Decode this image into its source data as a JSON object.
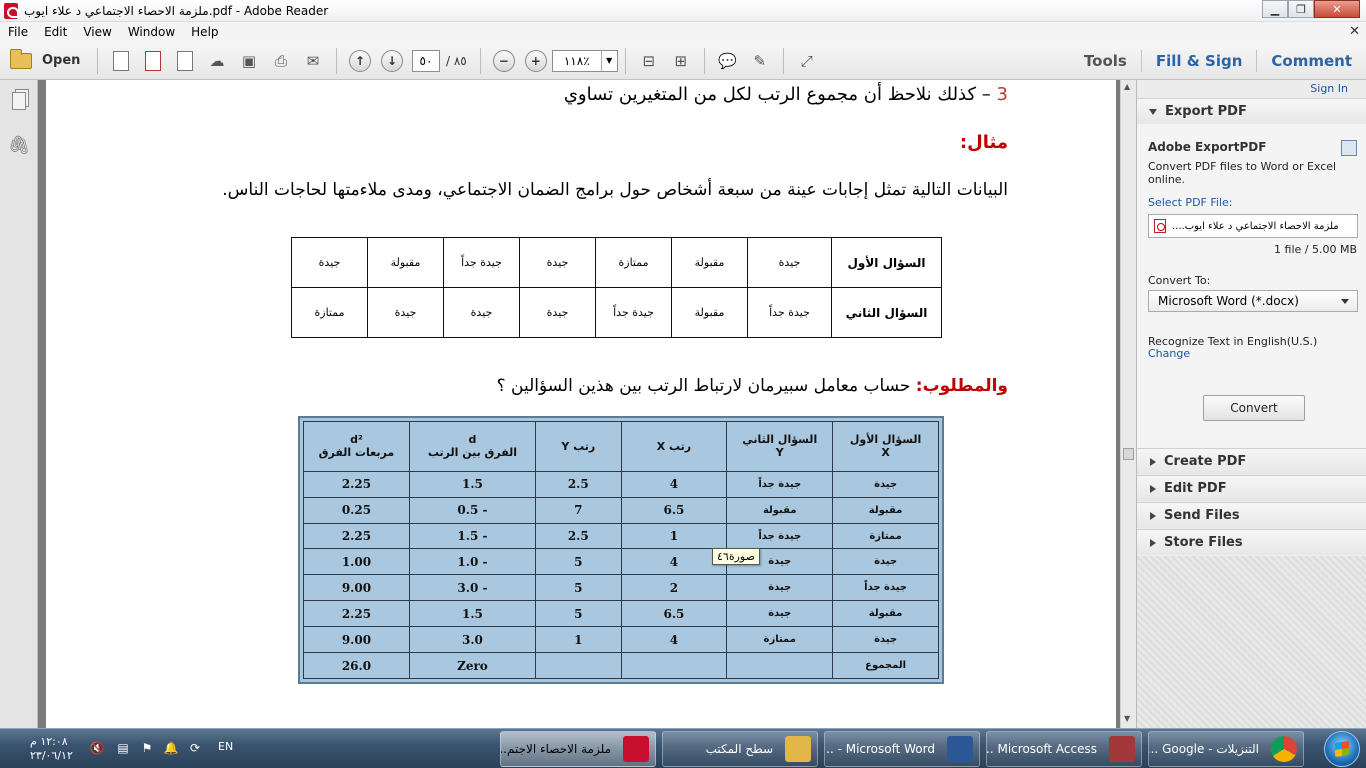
{
  "window": {
    "title": "ملزمة الاحصاء الاجتماعي د علاء ايوب.pdf - Adobe Reader"
  },
  "menu": [
    "File",
    "Edit",
    "View",
    "Window",
    "Help"
  ],
  "toolbar": {
    "open_label": "Open",
    "page_current": "٥٠",
    "page_total": "/ ٨٥",
    "zoom": "١١٨٪",
    "tools_label": "Tools",
    "fill_sign_label": "Fill & Sign",
    "comment_label": "Comment"
  },
  "document": {
    "line1_num": "3",
    "line1_text": "– كذلك نلاحظ أن مجموع الرتب لكل من المتغيرين تساوي",
    "example_heading": "مثال:",
    "intro_text": "البيانات التالية تمثل إجابات عينة من سبعة أشخاص حول برامج الضمان الاجتماعي، ومدى ملاءمتها لحاجات الناس.",
    "table1": {
      "rows": [
        [
          "السؤال الأول",
          "جيدة",
          "مقبولة",
          "ممتازة",
          "جيدة",
          "جيدة جداً",
          "مقبولة",
          "جيدة"
        ],
        [
          "السؤال الثاني",
          "جيدة جداً",
          "مقبولة",
          "جيدة جداً",
          "جيدة",
          "جيدة",
          "جيدة",
          "ممتازة"
        ]
      ]
    },
    "required_label": "والمطلوب:",
    "required_text": "حساب معامل سبيرمان لارتباط الرتب بين هذين السؤالين ؟",
    "table2": {
      "headers": [
        [
          "السؤال الأول",
          "X"
        ],
        [
          "السؤال الثاني",
          "Y"
        ],
        [
          "رتب X",
          ""
        ],
        [
          "رتب Y",
          ""
        ],
        [
          "d",
          "الفرق بين الرتب"
        ],
        [
          "d²",
          "مربعات الفرق"
        ]
      ],
      "rows": [
        [
          "جيدة",
          "جيدة جداً",
          "4",
          "2.5",
          "1.5",
          "2.25"
        ],
        [
          "مقبولة",
          "مقبولة",
          "6.5",
          "7",
          "- 0.5",
          "0.25"
        ],
        [
          "ممتازة",
          "جيدة جداً",
          "1",
          "2.5",
          "- 1.5",
          "2.25"
        ],
        [
          "جيدة",
          "جيدة",
          "4",
          "5",
          "- 1.0",
          "1.00"
        ],
        [
          "جيدة جداً",
          "جيدة",
          "2",
          "5",
          "- 3.0",
          "9.00"
        ],
        [
          "مقبولة",
          "جيدة",
          "6.5",
          "5",
          "1.5",
          "2.25"
        ],
        [
          "جيدة",
          "ممتازة",
          "4",
          "1",
          "3.0",
          "9.00"
        ],
        [
          "المجموع",
          "",
          "",
          "",
          "Zero",
          "26.0"
        ]
      ]
    },
    "tooltip": "صورة٤٦"
  },
  "rightpane": {
    "sign_in": "Sign In",
    "export_title": "Export PDF",
    "export_product": "Adobe ExportPDF",
    "export_desc_1": "Convert PDF files to Word or Excel",
    "export_desc_2": "online.",
    "select_file_label": "Select PDF File:",
    "file_name": "ملزمة الاحصاء الاجتماعي د علاء ايوب....",
    "file_count": "1 file / 5.00 MB",
    "convert_to_label": "Convert To:",
    "convert_to_value": "Microsoft Word (*.docx)",
    "recognize_text": "Recognize Text in English(U.S.)",
    "change_link": "Change",
    "convert_button": "Convert",
    "sections": [
      "Create PDF",
      "Edit PDF",
      "Send Files",
      "Store Files"
    ]
  },
  "taskbar": {
    "time": "١٢:٠٨ م",
    "date": "٢٣/٠٦/١٢",
    "lang": "EN",
    "tasks": [
      {
        "label": "ملزمة الاحصاء الاجتم...",
        "icon_color": "#c8102e"
      },
      {
        "label": "سطح المكتب",
        "icon_color": "#e3b64a"
      },
      {
        "label": "Microsoft Word - ...",
        "icon_color": "#2b5797"
      },
      {
        "label": "Microsoft Access ...",
        "icon_color": "#a4373a"
      },
      {
        "label": "التنزيلات - Google ...",
        "icon_color": "#3c9c3c"
      }
    ]
  }
}
